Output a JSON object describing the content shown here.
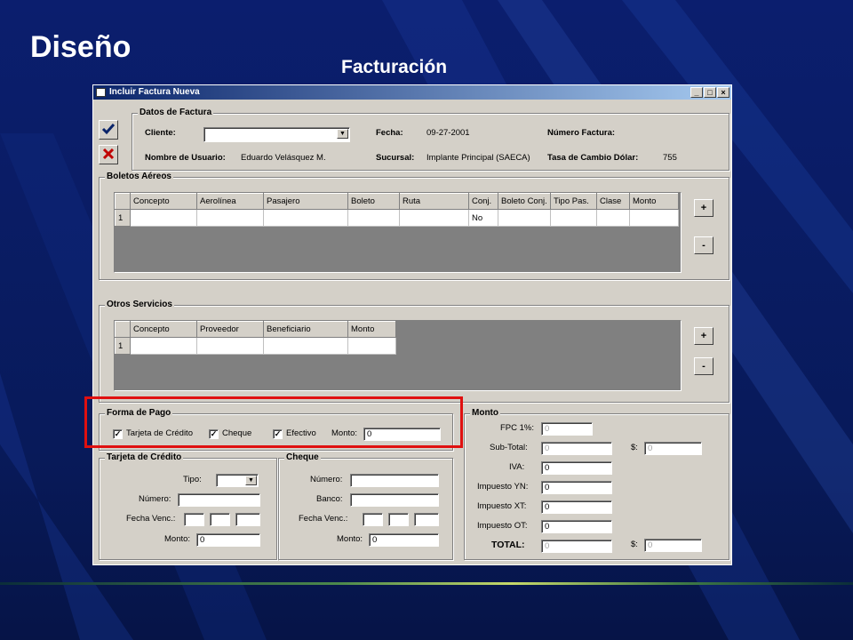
{
  "slide": {
    "title": "Diseño",
    "subtitle": "Facturación"
  },
  "colors": {
    "background": "#0b1e6e",
    "highlight": "#e01010",
    "titlebar": "#0a246a"
  },
  "window": {
    "title": "Incluir Factura Nueva",
    "buttons": {
      "minimize": "_",
      "maximize": "□",
      "close": "×"
    },
    "side_buttons": {
      "accept_icon": "checkmark-icon",
      "cancel_icon": "red-x-icon"
    }
  },
  "datos_factura": {
    "legend": "Datos de Factura",
    "cliente_label": "Cliente:",
    "cliente_value": "",
    "fecha_label": "Fecha:",
    "fecha_value": "09-27-2001",
    "numero_label": "Número Factura:",
    "usuario_label": "Nombre de Usuario:",
    "usuario_value": "Eduardo Velásquez M.",
    "sucursal_label": "Sucursal:",
    "sucursal_value": "Implante Principal (SAECA)",
    "tasa_label": "Tasa de Cambio Dólar:",
    "tasa_value": "755"
  },
  "boletos": {
    "legend": "Boletos Aéreos",
    "columns": [
      "Concepto",
      "Aerolínea",
      "Pasajero",
      "Boleto",
      "Ruta",
      "Conj.",
      "Boleto Conj.",
      "Tipo Pas.",
      "Clase",
      "Monto"
    ],
    "rows": [
      {
        "num": "1",
        "cells": [
          "",
          "",
          "",
          "",
          "",
          "No",
          "",
          "",
          "",
          ""
        ]
      }
    ],
    "add": "+",
    "remove": "-"
  },
  "otros": {
    "legend": "Otros Servicios",
    "columns": [
      "Concepto",
      "Proveedor",
      "Beneficiario",
      "Monto"
    ],
    "rows": [
      {
        "num": "1",
        "cells": [
          "",
          "",
          "",
          ""
        ]
      }
    ],
    "add": "+",
    "remove": "-"
  },
  "forma_pago": {
    "legend": "Forma de Pago",
    "tarjeta": "Tarjeta de Crédito",
    "cheque": "Cheque",
    "efectivo": "Efectivo",
    "check_mark": "✓",
    "monto_label": "Monto:",
    "monto_value": "0"
  },
  "tarjeta": {
    "legend": "Tarjeta de Crédito",
    "tipo_label": "Tipo:",
    "numero_label": "Número:",
    "fecha_label": "Fecha Venc.:",
    "monto_label": "Monto:",
    "monto_value": "0"
  },
  "cheque": {
    "legend": "Cheque",
    "numero_label": "Número:",
    "banco_label": "Banco:",
    "fecha_label": "Fecha Venc.:",
    "monto_label": "Monto:",
    "monto_value": "0"
  },
  "monto": {
    "legend": "Monto",
    "fpc_label": "FPC 1%:",
    "fpc_value": "0",
    "subtotal_label": "Sub-Total:",
    "subtotal_value": "0",
    "subtotal_usd_label": "$:",
    "subtotal_usd_value": "0",
    "iva_label": "IVA:",
    "iva_value": "0",
    "yn_label": "Impuesto YN:",
    "yn_value": "0",
    "xt_label": "Impuesto XT:",
    "xt_value": "0",
    "ot_label": "Impuesto OT:",
    "ot_value": "0",
    "total_label": "TOTAL:",
    "total_value": "0",
    "total_usd_label": "$:",
    "total_usd_value": "0"
  }
}
